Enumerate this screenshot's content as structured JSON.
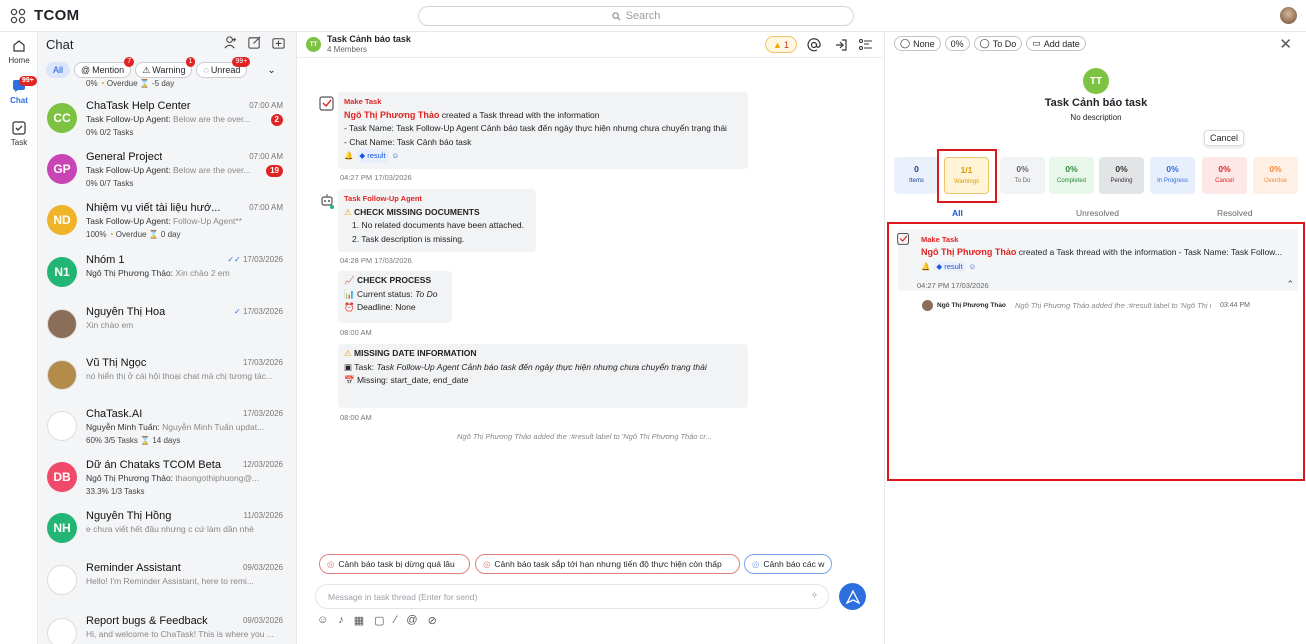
{
  "app": {
    "name": "TCOM",
    "search_placeholder": "Search"
  },
  "rail": [
    {
      "label": "Home",
      "icon": "home-icon"
    },
    {
      "label": "Chat",
      "icon": "chat-icon",
      "badge": "99+"
    },
    {
      "label": "Task",
      "icon": "task-icon"
    }
  ],
  "chat_list": {
    "title": "Chat",
    "filters": [
      {
        "label": "All"
      },
      {
        "label": "Mention",
        "count": "7"
      },
      {
        "label": "Warning",
        "count": "1"
      },
      {
        "label": "Unread",
        "count": "99+"
      }
    ],
    "partial_row": {
      "text": "0%",
      "overdue": "Overdue",
      "days": "-5 day"
    },
    "items": [
      {
        "initials": "CC",
        "color": "#7dc242",
        "name": "ChaTask Help Center",
        "time": "07:00 AM",
        "sender": "Task Follow-Up Agent:",
        "preview": "Below are the over...",
        "unread": "2",
        "meta": "0%  0/2 Tasks"
      },
      {
        "initials": "GP",
        "color": "#c945b5",
        "name": "General Project",
        "time": "07:00 AM",
        "sender": "Task Follow-Up Agent:",
        "preview": "Below are the over...",
        "unread": "19",
        "meta": "0%  0/7 Tasks"
      },
      {
        "initials": "ND",
        "color": "#f0b429",
        "name": "Nhiệm vụ viết tài liệu hướ...",
        "time": "07:00 AM",
        "sender": "Task Follow-Up Agent:",
        "preview": "Follow-Up Agent**",
        "meta": "100%",
        "overdue": "Overdue",
        "days": "0 day"
      },
      {
        "initials": "N1",
        "color": "#22b573",
        "name": "Nhóm 1",
        "time": "17/03/2026",
        "sender": "Ngô Thị Phương Thảo:",
        "preview": "Xin chào 2 em",
        "checks": "✓✓"
      },
      {
        "initials": "",
        "color": "#8a6e5a",
        "name": "Nguyễn Thị Hoa",
        "time": "17/03/2026",
        "sender": "",
        "preview": "Xin chào em",
        "checks": "✓"
      },
      {
        "initials": "",
        "color": "#b38b4a",
        "name": "Vũ Thị Ngọc",
        "time": "17/03/2026",
        "sender": "",
        "preview": "nó hiển thị ở cái hội thoại chat mà chị tương tác..."
      },
      {
        "initials": "",
        "color": "#ffffff",
        "name": "ChaTask.AI",
        "time": "17/03/2026",
        "sender": "Nguyễn Minh Tuấn:",
        "preview": "Nguyễn Minh Tuấn updat...",
        "meta": "60%  3/5 Tasks",
        "days": "14 days"
      },
      {
        "initials": "DB",
        "color": "#ef4a6a",
        "name": "Dữ án Chataks TCOM Beta",
        "time": "12/03/2026",
        "sender": "Ngô Thị Phương Thảo:",
        "preview": "thaongothiphuong@...",
        "meta": "33.3%  1/3 Tasks"
      },
      {
        "initials": "NH",
        "color": "#22b573",
        "name": "Nguyễn Thị Hồng",
        "time": "11/03/2026",
        "sender": "",
        "preview": "e chưa viết hết đâu nhưng c cứ làm dần nhé"
      },
      {
        "initials": "",
        "color": "#ffffff",
        "name": "Reminder Assistant",
        "time": "09/03/2026",
        "sender": "",
        "preview": "Hello! I'm Reminder Assistant, here to remi..."
      },
      {
        "initials": "",
        "color": "#ffffff",
        "name": "Report bugs & Feedback",
        "time": "09/03/2026",
        "sender": "",
        "preview": "Hi, and welcome to ChaTask! This is where you ..."
      }
    ]
  },
  "chat": {
    "avatar": "TT",
    "title": "Task Cảnh báo task",
    "members": "4 Members",
    "warning_count": "1",
    "msg1": {
      "label": "Make Task",
      "author": "Ngô Thị Phương Thảo",
      "action": "created a Task thread with the information",
      "line1": "- Task Name: Task Follow-Up Agent Cảnh báo task đến ngày thực hiện nhưng chưa chuyển trạng thái",
      "line2": "- Chat Name: Task Cảnh báo task",
      "tag": "result",
      "time": "04:27 PM 17/03/2026"
    },
    "msg2": {
      "label": "Task Follow-Up Agent",
      "heading": "CHECK MISSING DOCUMENTS",
      "item1": "1. No related documents have been attached.",
      "item2": "2. Task description is missing.",
      "time": "04:28 PM 17/03/2026"
    },
    "msg3": {
      "heading": "CHECK PROCESS",
      "status_label": "Current status:",
      "status_value": "To Do",
      "deadline_label": "Deadline:",
      "deadline_value": "None",
      "time": "08:00 AM"
    },
    "msg4": {
      "heading": "MISSING DATE INFORMATION",
      "task_label": "Task:",
      "task_value": "Task Follow-Up Agent Cảnh báo task đến ngày thực hiện nhưng chưa chuyển trạng thái",
      "missing": "Missing: start_date, end_date",
      "time": "08:00 AM"
    },
    "system_note": "Ngô Thị Phương Thảo added the :#result label to 'Ngô Thị Phương Thảo cr...",
    "quick_replies": [
      "Cảnh báo task bị dừng quá lâu",
      "Cảnh báo task sắp tới hạn nhưng tiến độ thực hiện còn thấp",
      "Cảnh báo các w"
    ],
    "composer_placeholder": "Message in task thread (Enter for send)"
  },
  "panel": {
    "status_buttons": [
      "None",
      "0%",
      "To Do",
      "Add date"
    ],
    "avatar": "TT",
    "title": "Task Cảnh báo task",
    "description": "No description",
    "tooltip": "Cancel",
    "stats": [
      {
        "value": "0",
        "label": "Items",
        "bg": "#eaf1fd",
        "fg": "#1a3f8f"
      },
      {
        "value": "1/1",
        "label": "Warnings",
        "bg": "#fff4d6",
        "fg": "#d99a00"
      },
      {
        "value": "0%",
        "label": "To Do",
        "bg": "#f2f3f5",
        "fg": "#666"
      },
      {
        "value": "0%",
        "label": "Completed",
        "bg": "#e7f7ea",
        "fg": "#2e8b3a"
      },
      {
        "value": "0%",
        "label": "Pending",
        "bg": "#e3e4e6",
        "fg": "#333"
      },
      {
        "value": "0%",
        "label": "In Progress",
        "bg": "#e7eefc",
        "fg": "#2e6fe0"
      },
      {
        "value": "0%",
        "label": "Cancel",
        "bg": "#fde7e7",
        "fg": "#e02424"
      },
      {
        "value": "0%",
        "label": "Overdue",
        "bg": "#fff0e6",
        "fg": "#f08a3c"
      }
    ],
    "tabs": [
      "All",
      "Unresolved",
      "Resolved"
    ],
    "thread": {
      "label": "Make Task",
      "author": "Ngô Thị Phương Thảo",
      "text": "created a Task thread with the information - Task Name: Task Follow...",
      "tag": "result",
      "time": "04:27 PM 17/03/2026",
      "reply_author": "Ngô Thị Phương Thảo",
      "reply_text": "Ngô Thị Phương Thảo added the :#result label to 'Ngô Thị Phương",
      "reply_time": "03:44 PM"
    }
  }
}
